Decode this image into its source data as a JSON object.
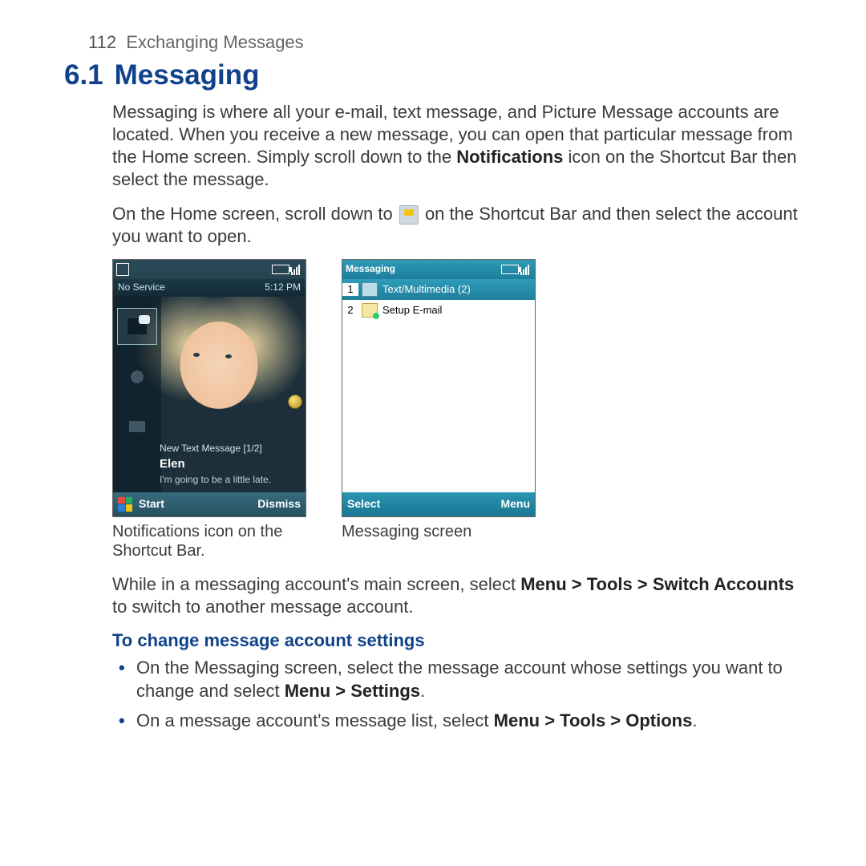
{
  "page": {
    "number": "112",
    "section": "Exchanging Messages"
  },
  "heading": {
    "number": "6.1",
    "title": "Messaging"
  },
  "p1": {
    "a": "Messaging is where all your e-mail, text message, and Picture Message accounts are located. When you receive a new message, you can open that particular message from the Home screen. Simply scroll down to the ",
    "b": "Notifications",
    "c": " icon on the Shortcut Bar then select the message."
  },
  "p2": {
    "a": "On the Home screen, scroll down to ",
    "b": " on the Shortcut Bar and then select the account you want to open."
  },
  "screenshot1": {
    "status_left": "No Service",
    "status_right": "5:12 PM",
    "notif_title": "New Text Message [1/2]",
    "notif_name": "Elen",
    "notif_body": "I'm going to be a little late.",
    "sk_left": "Start",
    "sk_right": "Dismiss",
    "caption": "Notifications icon on the Shortcut Bar."
  },
  "screenshot2": {
    "title": "Messaging",
    "rows": [
      {
        "idx": "1",
        "label": "Text/Multimedia (2)"
      },
      {
        "idx": "2",
        "label": "Setup E-mail"
      }
    ],
    "sk_left": "Select",
    "sk_right": "Menu",
    "caption": "Messaging screen"
  },
  "p3": {
    "a": "While in a messaging account's main screen, select ",
    "b": "Menu > Tools > Switch Accounts",
    "c": " to switch to another message account."
  },
  "subheading": "To change message account settings",
  "bullets": {
    "b1": {
      "a": "On the Messaging screen, select the message account whose settings you want to change and select ",
      "b": "Menu > Settings",
      "c": "."
    },
    "b2": {
      "a": "On a message account's message list, select ",
      "b": "Menu > Tools > Options",
      "c": "."
    }
  }
}
